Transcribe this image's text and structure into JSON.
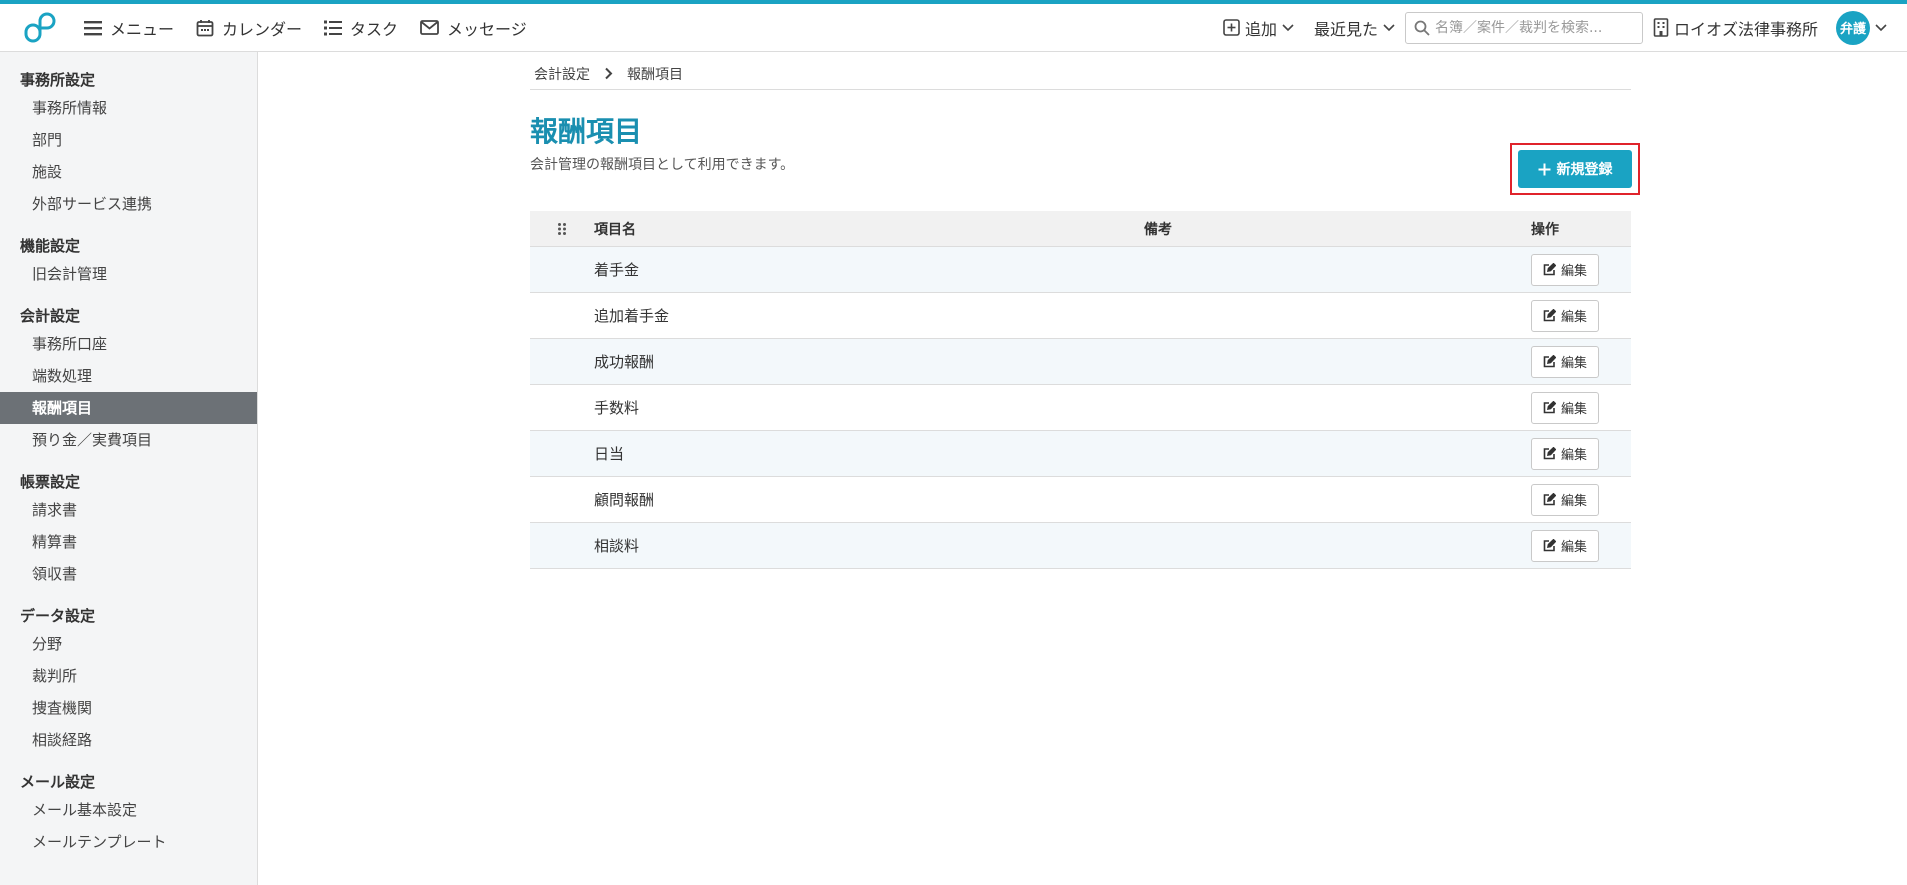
{
  "header": {
    "logo_icon": "logo-icon",
    "nav": {
      "menu": "メニュー",
      "calendar": "カレンダー",
      "task": "タスク",
      "message": "メッセージ"
    },
    "add": "追加",
    "recent": "最近見た",
    "search_placeholder": "名簿／案件／裁判を検索...",
    "office": "ロイオズ法律事務所",
    "avatar": "弁護"
  },
  "sidebar": {
    "office": {
      "title": "事務所設定",
      "items": [
        "事務所情報",
        "部門",
        "施設",
        "外部サービス連携"
      ]
    },
    "function": {
      "title": "機能設定",
      "items": [
        "旧会計管理"
      ]
    },
    "accounting": {
      "title": "会計設定",
      "items": [
        "事務所口座",
        "端数処理",
        "報酬項目",
        "預り金／実費項目"
      ]
    },
    "forms": {
      "title": "帳票設定",
      "items": [
        "請求書",
        "精算書",
        "領収書"
      ]
    },
    "data": {
      "title": "データ設定",
      "items": [
        "分野",
        "裁判所",
        "捜査機関",
        "相談経路"
      ]
    },
    "mail": {
      "title": "メール設定",
      "items": [
        "メール基本設定",
        "メールテンプレート"
      ]
    }
  },
  "breadcrumb": {
    "parent": "会計設定",
    "current": "報酬項目"
  },
  "page": {
    "title": "報酬項目",
    "description": "会計管理の報酬項目として利用できます。",
    "new_button": "新規登録"
  },
  "table": {
    "columns": {
      "name": "項目名",
      "note": "備考",
      "operation": "操作"
    },
    "edit_label": "編集",
    "rows": [
      {
        "name": "着手金",
        "note": ""
      },
      {
        "name": "追加着手金",
        "note": ""
      },
      {
        "name": "成功報酬",
        "note": ""
      },
      {
        "name": "手数料",
        "note": ""
      },
      {
        "name": "日当",
        "note": ""
      },
      {
        "name": "顧問報酬",
        "note": ""
      },
      {
        "name": "相談料",
        "note": ""
      }
    ]
  },
  "colors": {
    "accent": "#1aa3c3",
    "title": "#1a8fb0",
    "highlight": "#e0232b",
    "active_sidebar": "#6c7176"
  }
}
